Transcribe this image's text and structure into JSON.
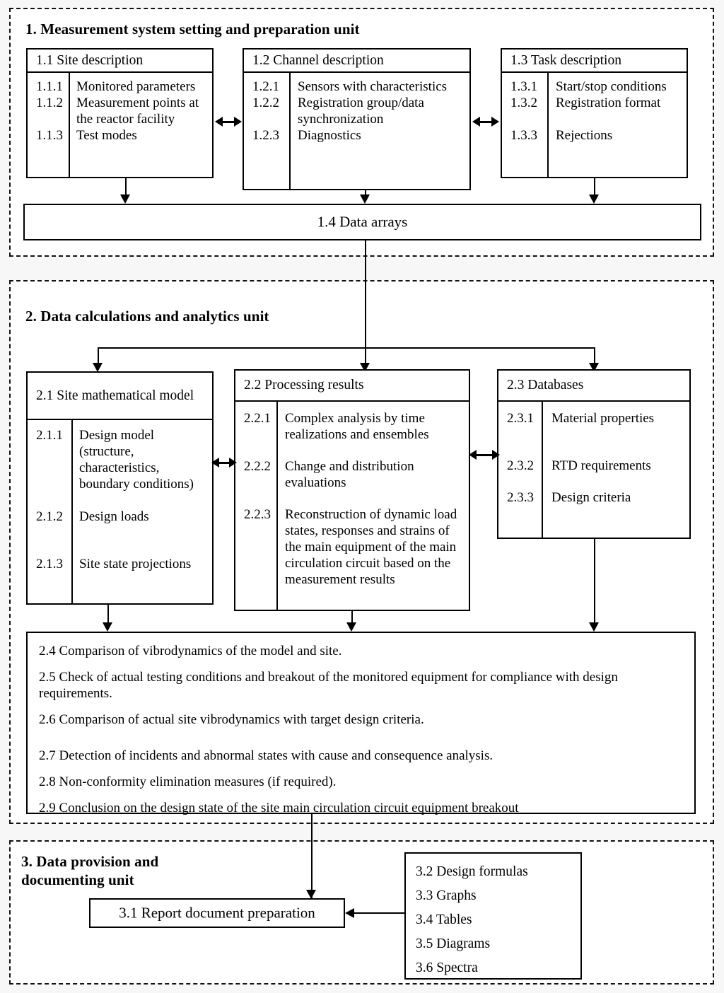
{
  "units": [
    {
      "id": "unit1",
      "title": "1. Measurement system setting and preparation unit"
    },
    {
      "id": "unit2",
      "title": "2. Data calculations and analytics unit"
    },
    {
      "id": "unit3",
      "title": "3. Data provision and\ndocumenting unit"
    }
  ],
  "box_1_1": {
    "header": "1.1 Site description",
    "rows": [
      {
        "num": "1.1.1",
        "text": "Monitored parameters"
      },
      {
        "num": "1.1.2",
        "text": "Measurement points at the reactor facility"
      },
      {
        "num": "1.1.3",
        "text": "Test modes"
      }
    ]
  },
  "box_1_2": {
    "header": "1.2 Channel description",
    "rows": [
      {
        "num": "1.2.1",
        "text": "Sensors with characteristics"
      },
      {
        "num": "1.2.2",
        "text": "Registration group/data synchronization"
      },
      {
        "num": "1.2.3",
        "text": "Diagnostics"
      }
    ]
  },
  "box_1_3": {
    "header": "1.3 Task description",
    "rows": [
      {
        "num": "1.3.1",
        "text": "Start/stop conditions"
      },
      {
        "num": "1.3.2",
        "text": "Registration format"
      },
      {
        "num": "1.3.3",
        "text": "Rejections"
      }
    ]
  },
  "box_1_4": {
    "label": "1.4 Data arrays"
  },
  "box_2_1": {
    "header": "2.1 Site mathematical model",
    "rows": [
      {
        "num": "2.1.1",
        "text": "Design model (structure, characteristics, boundary conditions)"
      },
      {
        "num": "2.1.2",
        "text": "Design loads"
      },
      {
        "num": "2.1.3",
        "text": "Site state projections"
      }
    ]
  },
  "box_2_2": {
    "header": "2.2 Processing results",
    "rows": [
      {
        "num": "2.2.1",
        "text": "Complex analysis by time realizations and ensembles"
      },
      {
        "num": "2.2.2",
        "text": "Change and distribution evaluations"
      },
      {
        "num": "2.2.3",
        "text": "Reconstruction of dynamic load states, responses and strains of the main equipment of the main circulation circuit based on the measurement results"
      }
    ]
  },
  "box_2_3": {
    "header": "2.3 Databases",
    "rows": [
      {
        "num": "2.3.1",
        "text": "Material properties"
      },
      {
        "num": "2.3.2",
        "text": "RTD requirements"
      },
      {
        "num": "2.3.3",
        "text": "Design criteria"
      }
    ]
  },
  "box_2_conclusions": {
    "items": [
      "2.4 Comparison of vibrodynamics of the model and site.",
      "2.5 Check of actual testing conditions and breakout of the monitored equipment for compliance with design requirements.",
      "2.6 Comparison of actual site vibrodynamics with target design criteria.",
      "2.7 Detection of incidents and abnormal states with cause and consequence analysis.",
      "2.8 Non-conformity elimination measures (if required).",
      "2.9 Conclusion on the design state of the site main circulation circuit equipment breakout"
    ]
  },
  "box_3_1": {
    "label": "3.1 Report document preparation"
  },
  "box_3_outputs": {
    "items": [
      "3.2 Design formulas",
      "3.3 Graphs",
      "3.4 Tables",
      "3.5 Diagrams",
      "3.6 Spectra"
    ]
  },
  "colors": {
    "line": "#000000",
    "background": "#f7f7f7",
    "box_fill": "#ffffff"
  }
}
